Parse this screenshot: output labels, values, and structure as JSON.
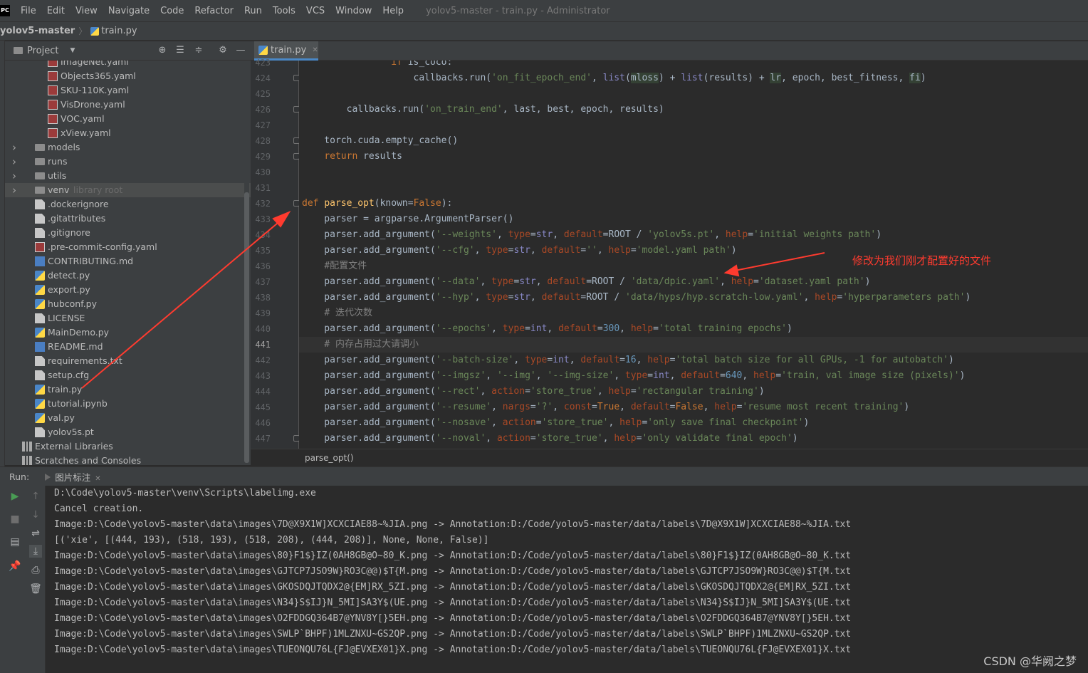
{
  "app": {
    "logo": "PC",
    "menu": [
      "File",
      "Edit",
      "View",
      "Navigate",
      "Code",
      "Refactor",
      "Run",
      "Tools",
      "VCS",
      "Window",
      "Help"
    ],
    "window_title": "yolov5-master - train.py - Administrator"
  },
  "navbar": {
    "project": "yolov5-master",
    "file": "train.py"
  },
  "project_panel": {
    "title": "Project",
    "tree": [
      {
        "label": "ImageNet.yaml",
        "type": "yaml",
        "indent": 2,
        "partial": true
      },
      {
        "label": "Objects365.yaml",
        "type": "yaml",
        "indent": 2
      },
      {
        "label": "SKU-110K.yaml",
        "type": "yaml",
        "indent": 2
      },
      {
        "label": "VisDrone.yaml",
        "type": "yaml",
        "indent": 2
      },
      {
        "label": "VOC.yaml",
        "type": "yaml",
        "indent": 2
      },
      {
        "label": "xView.yaml",
        "type": "yaml",
        "indent": 2
      },
      {
        "label": "models",
        "type": "folder",
        "indent": 1,
        "arrow": true
      },
      {
        "label": "runs",
        "type": "folder",
        "indent": 1,
        "arrow": true
      },
      {
        "label": "utils",
        "type": "folder",
        "indent": 1,
        "arrow": true
      },
      {
        "label": "venv",
        "hint": "library root",
        "type": "folder",
        "indent": 1,
        "arrow": true,
        "selected": true
      },
      {
        "label": ".dockerignore",
        "type": "file",
        "indent": 1
      },
      {
        "label": ".gitattributes",
        "type": "file",
        "indent": 1
      },
      {
        "label": ".gitignore",
        "type": "file",
        "indent": 1
      },
      {
        "label": ".pre-commit-config.yaml",
        "type": "yaml",
        "indent": 1
      },
      {
        "label": "CONTRIBUTING.md",
        "type": "md",
        "indent": 1
      },
      {
        "label": "detect.py",
        "type": "py",
        "indent": 1
      },
      {
        "label": "export.py",
        "type": "py",
        "indent": 1
      },
      {
        "label": "hubconf.py",
        "type": "py",
        "indent": 1
      },
      {
        "label": "LICENSE",
        "type": "file",
        "indent": 1
      },
      {
        "label": "MainDemo.py",
        "type": "py",
        "indent": 1
      },
      {
        "label": "README.md",
        "type": "md",
        "indent": 1
      },
      {
        "label": "requirements.txt",
        "type": "file",
        "indent": 1
      },
      {
        "label": "setup.cfg",
        "type": "file",
        "indent": 1
      },
      {
        "label": "train.py",
        "type": "py",
        "indent": 1
      },
      {
        "label": "tutorial.ipynb",
        "type": "py",
        "indent": 1
      },
      {
        "label": "val.py",
        "type": "py",
        "indent": 1
      },
      {
        "label": "yolov5s.pt",
        "type": "file",
        "indent": 1
      },
      {
        "label": "External Libraries",
        "type": "lib",
        "indent": 0,
        "arrow": true
      },
      {
        "label": "Scratches and Consoles",
        "type": "lib",
        "indent": 0
      }
    ]
  },
  "editor": {
    "tab": "train.py",
    "current_line": 441,
    "breadcrumb": "parse_opt()",
    "annotation": "修改为我们刚才配置好的文件",
    "lines": [
      {
        "n": 423,
        "html": "                <span class=\"kw\">if</span> is_coco:",
        "clip": true
      },
      {
        "n": 424,
        "html": "                    callbacks.run(<span class=\"str\">'on_fit_epoch_end'</span>, <span class=\"bi\">list</span>(<span class=\"hl\">mloss</span>) + <span class=\"bi\">list</span>(results) + <span class=\"hl\">lr</span>, epoch, best_fitness, <span class=\"hl\">fi</span>)"
      },
      {
        "n": 425,
        "html": ""
      },
      {
        "n": 426,
        "html": "        callbacks.run(<span class=\"str\">'on_train_end'</span>, last, best, epoch, results)"
      },
      {
        "n": 427,
        "html": ""
      },
      {
        "n": 428,
        "html": "    torch.cuda.empty_cache()"
      },
      {
        "n": 429,
        "html": "    <span class=\"kw\">return</span> results"
      },
      {
        "n": 430,
        "html": ""
      },
      {
        "n": 431,
        "html": ""
      },
      {
        "n": 432,
        "html": "<span class=\"kw\">def</span> <span class=\"fn\">parse_opt</span>(known=<span class=\"kw\">False</span>):"
      },
      {
        "n": 433,
        "html": "    parser = argparse.ArgumentParser()"
      },
      {
        "n": 434,
        "html": "    parser.add_argument(<span class=\"str\">'--weights'</span>, <span class=\"kwarg\">type</span>=<span class=\"bi\">str</span>, <span class=\"kwarg\">default</span>=ROOT / <span class=\"str\">'yolov5s.pt'</span>, <span class=\"kwarg\">help</span>=<span class=\"str\">'initial weights path'</span>)"
      },
      {
        "n": 435,
        "html": "    parser.add_argument(<span class=\"str\">'--cfg'</span>, <span class=\"kwarg\">type</span>=<span class=\"bi\">str</span>, <span class=\"kwarg\">default</span>=<span class=\"str\">''</span>, <span class=\"kwarg\">help</span>=<span class=\"str\">'model.yaml path'</span>)"
      },
      {
        "n": 436,
        "html": "    <span class=\"cm\">#配置文件</span>"
      },
      {
        "n": 437,
        "html": "    parser.add_argument(<span class=\"str\">'--data'</span>, <span class=\"kwarg\">type</span>=<span class=\"bi\">str</span>, <span class=\"kwarg\">default</span>=ROOT / <span class=\"str\">'data/dpic.yaml'</span>, <span class=\"kwarg\">help</span>=<span class=\"str\">'dataset.yaml path'</span>)"
      },
      {
        "n": 438,
        "html": "    parser.add_argument(<span class=\"str\">'--hyp'</span>, <span class=\"kwarg\">type</span>=<span class=\"bi\">str</span>, <span class=\"kwarg\">default</span>=ROOT / <span class=\"str\">'data/hyps/hyp.scratch-low.yaml'</span>, <span class=\"kwarg\">help</span>=<span class=\"str\">'hyperparameters path'</span>)"
      },
      {
        "n": 439,
        "html": "    <span class=\"cm\"># 迭代次数</span>"
      },
      {
        "n": 440,
        "html": "    parser.add_argument(<span class=\"str\">'--epochs'</span>, <span class=\"kwarg\">type</span>=<span class=\"bi\">int</span>, <span class=\"kwarg\">default</span>=<span class=\"num\">300</span>, <span class=\"kwarg\">help</span>=<span class=\"str\">'total training epochs'</span>)"
      },
      {
        "n": 441,
        "html": "    <span class=\"cm\"># 内存占用过大请调小</span>"
      },
      {
        "n": 442,
        "html": "    parser.add_argument(<span class=\"str\">'--batch-size'</span>, <span class=\"kwarg\">type</span>=<span class=\"bi\">int</span>, <span class=\"kwarg\">default</span>=<span class=\"num\">16</span>, <span class=\"kwarg\">help</span>=<span class=\"str\">'total batch size for all GPUs, -1 for autobatch'</span>)"
      },
      {
        "n": 443,
        "html": "    parser.add_argument(<span class=\"str\">'--imgsz'</span>, <span class=\"str\">'--img'</span>, <span class=\"str\">'--img-size'</span>, <span class=\"kwarg\">type</span>=<span class=\"bi\">int</span>, <span class=\"kwarg\">default</span>=<span class=\"num\">640</span>, <span class=\"kwarg\">help</span>=<span class=\"str\">'train, val image size (pixels)'</span>)"
      },
      {
        "n": 444,
        "html": "    parser.add_argument(<span class=\"str\">'--rect'</span>, <span class=\"kwarg\">action</span>=<span class=\"str\">'store_true'</span>, <span class=\"kwarg\">help</span>=<span class=\"str\">'rectangular training'</span>)"
      },
      {
        "n": 445,
        "html": "    parser.add_argument(<span class=\"str\">'--resume'</span>, <span class=\"kwarg\">nargs</span>=<span class=\"str\">'?'</span>, <span class=\"kwarg\">const</span>=<span class=\"kw\">True</span>, <span class=\"kwarg\">default</span>=<span class=\"kw\">False</span>, <span class=\"kwarg\">help</span>=<span class=\"str\">'resume most recent training'</span>)"
      },
      {
        "n": 446,
        "html": "    parser.add_argument(<span class=\"str\">'--nosave'</span>, <span class=\"kwarg\">action</span>=<span class=\"str\">'store_true'</span>, <span class=\"kwarg\">help</span>=<span class=\"str\">'only save final checkpoint'</span>)"
      },
      {
        "n": 447,
        "html": "    parser.add_argument(<span class=\"str\">'--noval'</span>, <span class=\"kwarg\">action</span>=<span class=\"str\">'store_true'</span>, <span class=\"kwarg\">help</span>=<span class=\"str\">'only validate final epoch'</span>)"
      }
    ]
  },
  "run_panel": {
    "label": "Run:",
    "tab": "图片标注",
    "console": [
      "D:\\Code\\yolov5-master\\venv\\Scripts\\labelimg.exe",
      "Cancel creation.",
      "Image:D:\\Code\\yolov5-master\\data\\images\\7D@X9X1W]XCXCIAE88~%JIA.png -> Annotation:D:/Code/yolov5-master/data/labels\\7D@X9X1W]XCXCIAE88~%JIA.txt",
      "[('xie', [(444, 193), (518, 193), (518, 208), (444, 208)], None, None, False)]",
      "Image:D:\\Code\\yolov5-master\\data\\images\\80}F1$}IZ(0AH8GB@O~80_K.png -> Annotation:D:/Code/yolov5-master/data/labels\\80}F1$}IZ(0AH8GB@O~80_K.txt",
      "Image:D:\\Code\\yolov5-master\\data\\images\\GJTCP7JSO9W}RO3C@@)$T{M.png -> Annotation:D:/Code/yolov5-master/data/labels\\GJTCP7JSO9W}RO3C@@)$T{M.txt",
      "Image:D:\\Code\\yolov5-master\\data\\images\\GKOSDQJTQDX2@{EM]RX_5ZI.png -> Annotation:D:/Code/yolov5-master/data/labels\\GKOSDQJTQDX2@{EM]RX_5ZI.txt",
      "Image:D:\\Code\\yolov5-master\\data\\images\\N34}S$IJ}N_5MI]SA3Y$(UE.png -> Annotation:D:/Code/yolov5-master/data/labels\\N34}S$IJ}N_5MI]SA3Y$(UE.txt",
      "Image:D:\\Code\\yolov5-master\\data\\images\\O2FDDGQ364B7@YNV8Y[}5EH.png -> Annotation:D:/Code/yolov5-master/data/labels\\O2FDDGQ364B7@YNV8Y[}5EH.txt",
      "Image:D:\\Code\\yolov5-master\\data\\images\\SWLP`BHPF)1MLZNXU~GS2QP.png -> Annotation:D:/Code/yolov5-master/data/labels\\SWLP`BHPF)1MLZNXU~GS2QP.txt",
      "Image:D:\\Code\\yolov5-master\\data\\images\\TUEONQU76L{FJ@EVXEX01}X.png -> Annotation:D:/Code/yolov5-master/data/labels\\TUEONQU76L{FJ@EVXEX01}X.txt"
    ]
  },
  "watermark": "CSDN @华阙之梦",
  "colors": {
    "accent_tab": "#4a88c7",
    "annotation": "#ff3b2f",
    "run_green": "#499c54"
  }
}
